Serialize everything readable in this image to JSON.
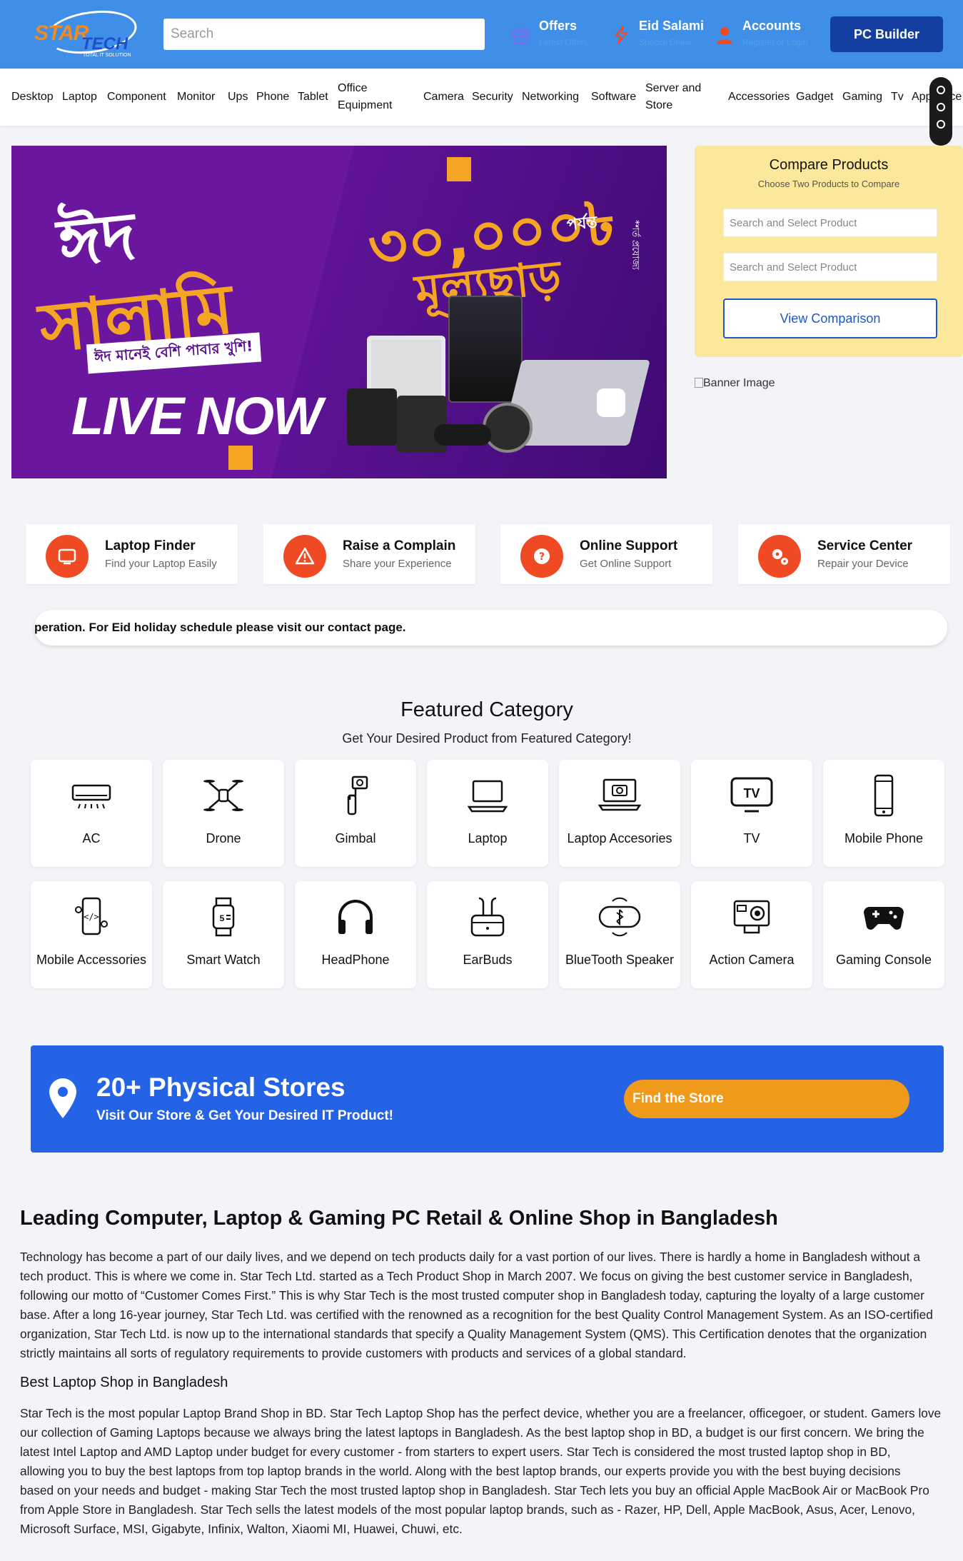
{
  "header": {
    "logo_text_1": "STAR",
    "logo_text_2": "TECH",
    "logo_tagline": "TOTAL IT SOLUTION",
    "search_placeholder": "Search",
    "items": [
      {
        "title": "Offers",
        "subtitle": "Latest Offers",
        "icon": "gift-icon"
      },
      {
        "title": "Eid Salami",
        "subtitle": "Special Deals",
        "icon": "flash-icon"
      },
      {
        "title": "Accounts",
        "subtitle": "Register or Login",
        "icon": "user-icon"
      }
    ],
    "pc_builder": "PC Builder"
  },
  "nav": [
    "Desktop",
    "Laptop",
    "Component",
    "Monitor",
    "Ups",
    "Phone",
    "Tablet",
    "Office Equipment",
    "Camera",
    "Security",
    "Networking",
    "Software",
    "Server and Store",
    "Accessories",
    "Gadget",
    "Gaming",
    "Tv",
    "Appliance"
  ],
  "hero": {
    "headline_1": "ঈদ",
    "headline_2": "সালামি",
    "tagline": "ঈদ মানেই বেশি পাবার খুশি!",
    "cta": "LIVE NOW",
    "amount": "৩০,০০০৳",
    "amount_suffix": "পর্যন্ত",
    "discount": "মূল্যছাড়",
    "terms": "*শর্ত প্রযোজ্য"
  },
  "compare": {
    "title": "Compare Products",
    "subtitle": "Choose Two Products to Compare",
    "input_1_placeholder": "Search and Select Product",
    "input_2_placeholder": "Search and Select Product",
    "button": "View Comparison"
  },
  "banner_alt": "Banner Image",
  "services": [
    {
      "title": "Laptop Finder",
      "subtitle": "Find your Laptop Easily",
      "icon": "laptop-icon"
    },
    {
      "title": "Raise a Complain",
      "subtitle": "Share your Experience",
      "icon": "warning-icon"
    },
    {
      "title": "Online Support",
      "subtitle": "Get Online Support",
      "icon": "help-icon"
    },
    {
      "title": "Service Center",
      "subtitle": "Repair your Device",
      "icon": "gears-icon"
    }
  ],
  "notice": "peration. For Eid holiday schedule please visit our contact page.",
  "featured": {
    "title": "Featured Category",
    "subtitle": "Get Your Desired Product from Featured Category!",
    "categories": [
      {
        "label": "AC",
        "icon": "ac-icon"
      },
      {
        "label": "Drone",
        "icon": "drone-icon"
      },
      {
        "label": "Gimbal",
        "icon": "gimbal-icon"
      },
      {
        "label": "Laptop",
        "icon": "laptop-icon"
      },
      {
        "label": "Laptop Accesories",
        "icon": "laptop-accessories-icon"
      },
      {
        "label": "TV",
        "icon": "tv-icon"
      },
      {
        "label": "Mobile Phone",
        "icon": "mobile-phone-icon"
      },
      {
        "label": "Mobile Accessories",
        "icon": "mobile-accessories-icon"
      },
      {
        "label": "Smart Watch",
        "icon": "smart-watch-icon"
      },
      {
        "label": "HeadPhone",
        "icon": "headphone-icon"
      },
      {
        "label": "EarBuds",
        "icon": "earbuds-icon"
      },
      {
        "label": "BlueTooth Speaker",
        "icon": "bluetooth-speaker-icon"
      },
      {
        "label": "Action Camera",
        "icon": "action-camera-icon"
      },
      {
        "label": "Gaming Console",
        "icon": "gaming-console-icon"
      }
    ]
  },
  "stores": {
    "title": "20+ Physical Stores",
    "subtitle": "Visit Our Store & Get Your Desired IT Product!",
    "button": "Find the Store"
  },
  "article": {
    "heading": "Leading Computer, Laptop & Gaming PC Retail & Online Shop in Bangladesh",
    "para1_lines": [
      "Technology has become a part of our daily lives, and we depend on tech products daily for a vast portion of our lives. There is hardly a home in Bangladesh without a",
      "tech product. This is where we come in. Star Tech Ltd. started as a Tech Product Shop in March 2007. We focus on giving the best customer service in Bangladesh,",
      "following our motto of “Customer Comes First.” This is why Star Tech is the most trusted computer shop in Bangladesh today, capturing the loyalty of a large customer",
      "base. After a long 16-year journey, Star Tech Ltd. was certified with the renowned as a recognition for the best Quality Control Management System. As an ISO-certified",
      "organization, Star Tech Ltd. is now up to the international standards that specify a Quality Management System (QMS). This Certification denotes that the organization",
      "strictly maintains all sorts of regulatory requirements to provide customers with products and services of a global standard."
    ],
    "subheading": "Best Laptop Shop in Bangladesh",
    "para2_lines": [
      "Star Tech is the most popular Laptop Brand Shop in BD. Star Tech Laptop Shop has the perfect device, whether you are a freelancer, officegoer, or student. Gamers love",
      "our collection of Gaming Laptops because we always bring the latest laptops in Bangladesh. As the best laptop shop in BD, a budget is our first concern. We bring the",
      "latest Intel Laptop and AMD Laptop under budget for every customer - from starters to expert users. Star Tech is considered the most trusted laptop shop in BD,",
      "allowing you to buy the best laptops from top laptop brands in the world. Along with the best laptop brands, our experts provide you with the best buying decisions",
      "based on your needs and budget - making Star Tech the most trusted laptop shop in Bangladesh. Star Tech lets you buy an official Apple MacBook Air or MacBook Pro",
      "from Apple Store in Bangladesh. Star Tech sells the latest models of the most popular laptop brands, such as - Razer, HP, Dell, Apple MacBook, Asus, Acer, Lenovo,",
      "Microsoft Surface, MSI, Gigabyte, Infinix, Walton, Xiaomi MI, Huawei, Chuwi, etc."
    ]
  },
  "colors": {
    "header_bg": "#3f8fe9",
    "brand_orange": "#ef4a23",
    "stores_bg": "#2563e6",
    "compare_bg": "#fce89a"
  }
}
